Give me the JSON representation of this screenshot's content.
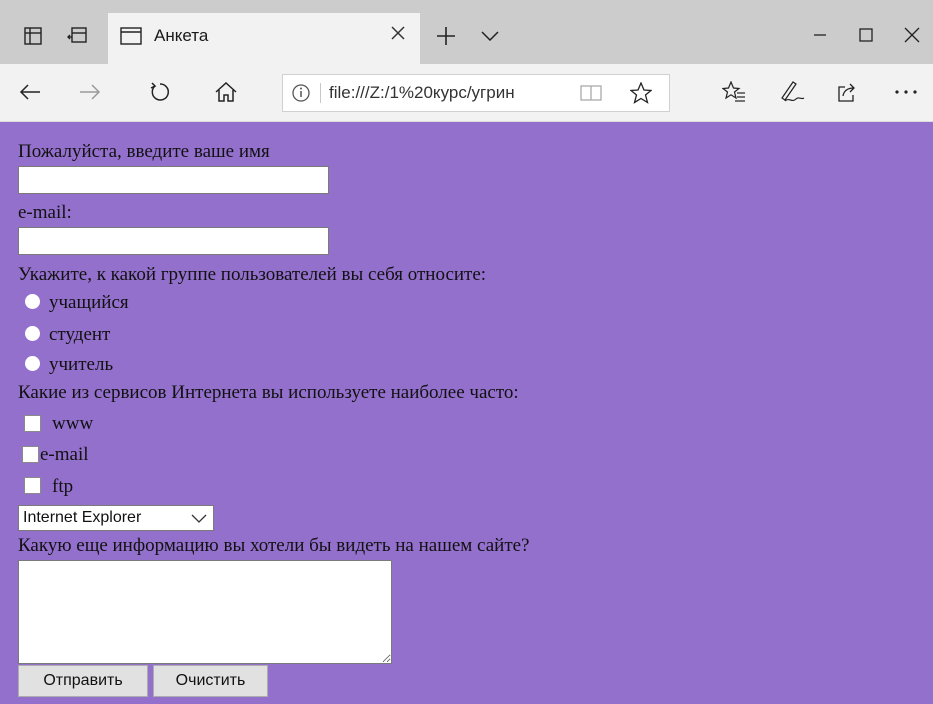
{
  "browser": {
    "tab_title": "Анкета",
    "address_url": "file:///Z:/1%20курс/угрин",
    "icons": {
      "set_aside_tabs": "tabs-aside-icon",
      "back_tabs": "tabs-restore-icon",
      "tab_page": "page-icon",
      "close_tab": "close-icon",
      "new_tab": "plus-icon",
      "tab_menu": "chevron-down-icon",
      "minimize": "minimize-icon",
      "maximize": "maximize-icon",
      "close_window": "close-icon",
      "back": "arrow-left-icon",
      "forward": "arrow-right-icon",
      "refresh": "refresh-icon",
      "home": "home-icon",
      "info": "info-icon",
      "reading_view": "book-icon",
      "favorite": "star-icon",
      "favorites_list": "favorites-icon",
      "notes": "pen-icon",
      "share": "share-icon",
      "more": "more-icon"
    }
  },
  "form": {
    "name_label": "Пожалуйста, введите ваше имя",
    "name_value": "",
    "email_label": "e-mail:",
    "email_value": "",
    "group_label": "Укажите, к какой группе пользователей вы себя относите:",
    "groups": [
      "учащийся",
      "студент",
      "учитель"
    ],
    "services_label": "Какие из сервисов Интернета вы используете наиболее часто:",
    "services": [
      "www",
      "e-mail",
      "ftp"
    ],
    "browser_select_value": "Internet Explorer",
    "info_label": "Какую еще информацию вы хотели бы видеть на нашем сайте?",
    "info_value": "",
    "submit_label": "Отправить",
    "reset_label": "Очистить"
  },
  "colors": {
    "page_background": "#9370cc",
    "tabstrip": "#cccccc",
    "toolbar": "#f2f2f2"
  }
}
